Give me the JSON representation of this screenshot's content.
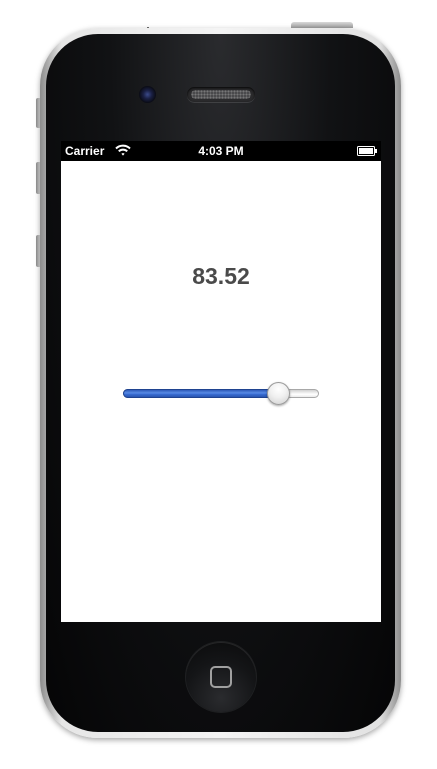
{
  "device": {
    "model_style": "iPhone 4",
    "body_color": "#0b0b0c",
    "bezel_color": "#e4e4e4"
  },
  "status_bar": {
    "carrier": "Carrier",
    "time": "4:03 PM",
    "wifi_icon": "wifi-icon",
    "battery_icon": "battery-icon"
  },
  "screen": {
    "value_label": "83.52",
    "slider": {
      "value": 83.52,
      "min": 0,
      "max": 100,
      "min_track_color": "#3a6fd6",
      "max_track_color": "#f2f2f2"
    }
  },
  "icons": {
    "camera": "camera-icon",
    "speaker": "speaker-grille",
    "home": "home-button-icon"
  }
}
